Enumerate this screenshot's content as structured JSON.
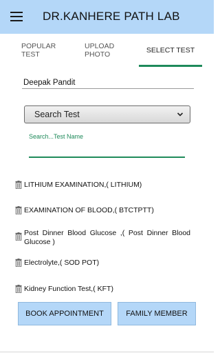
{
  "app": {
    "title": "DR.KANHERE PATH LAB"
  },
  "icons": {
    "menu": "menu-icon",
    "chevron": "chevron-down-icon",
    "delete": "trash-icon"
  },
  "colors": {
    "appbar": "#b4d7f8",
    "accent": "#1e8a5a",
    "button": "#b4d7f8"
  },
  "tabs": [
    {
      "label": "POPULAR TEST",
      "line1": "POPULAR",
      "line2": "TEST",
      "selected": false
    },
    {
      "label": "UPLOAD PHOTO",
      "line1": "UPLOAD",
      "line2": "PHOTO",
      "selected": false
    },
    {
      "label": "SELECT TEST",
      "line1": "SELECT TEST",
      "line2": "",
      "selected": true
    }
  ],
  "form": {
    "patient_name": "Deepak Pandit",
    "select_value": "Search Test",
    "search_label": "Search...Test Name",
    "search_value": ""
  },
  "tests": [
    {
      "name": "LITHIUM EXAMINATION,( LITHIUM)"
    },
    {
      "name": "EXAMINATION OF BLOOD,( BTCTPTT)"
    },
    {
      "name": "Post Dinner Blood Glucose ,( Post Dinner Blood Glucose )"
    },
    {
      "name": "Electrolyte,( SOD POT)"
    },
    {
      "name": "Kidney Function Test,( KFT)"
    }
  ],
  "buttons": {
    "book": "BOOK APPOINTMENT",
    "family": "FAMILY MEMBER"
  }
}
